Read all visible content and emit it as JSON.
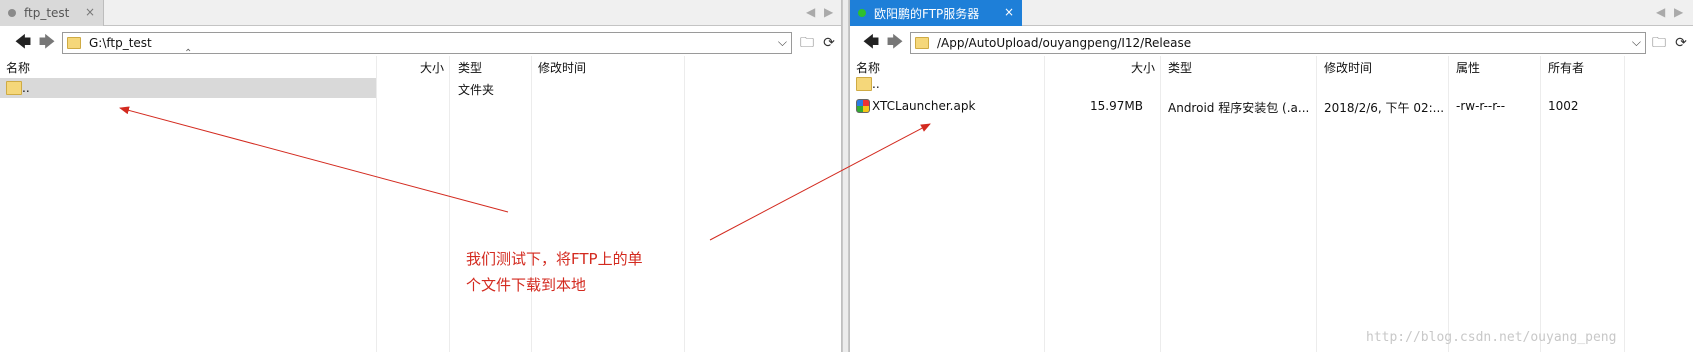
{
  "left": {
    "tab": {
      "label": "ftp_test",
      "close": "×"
    },
    "tab_nav": {
      "prev": "◀",
      "next": "▶"
    },
    "path": "G:\\ftp_test",
    "columns": {
      "name": "名称",
      "size": "大小",
      "type": "类型",
      "modified": "修改时间"
    },
    "rows": [
      {
        "name": "..",
        "size": "",
        "type": "文件夹",
        "modified": ""
      }
    ]
  },
  "right": {
    "tab": {
      "label": "欧阳鹏的FTP服务器",
      "close": "×"
    },
    "tab_nav": {
      "prev": "◀",
      "next": "▶"
    },
    "path": "/App/AutoUpload/ouyangpeng/I12/Release",
    "columns": {
      "name": "名称",
      "size": "大小",
      "type": "类型",
      "modified": "修改时间",
      "perms": "属性",
      "owner": "所有者"
    },
    "rows": [
      {
        "name": "..",
        "size": "",
        "type": "",
        "modified": "",
        "perms": "",
        "owner": ""
      },
      {
        "name": "XTCLauncher.apk",
        "size": "15.97MB",
        "type": "Android 程序安装包 (.a...",
        "modified": "2018/2/6, 下午 02:...",
        "perms": "-rw-r--r--",
        "owner": "1002"
      }
    ]
  },
  "icons": {
    "back": "arrow-left-icon",
    "forward": "arrow-right-icon",
    "dropdown": "chevron-down-icon",
    "new_folder": "new-folder-icon",
    "refresh": "refresh-icon"
  },
  "annotation": {
    "line1": "我们测试下，将FTP上的单",
    "line2": "个文件下载到本地"
  },
  "watermark": "http://blog.csdn.net/ouyang_peng",
  "colors": {
    "active_tab": "#1e7fd8",
    "annotation": "#d32a1f",
    "connected_dot": "#2ec02e"
  }
}
